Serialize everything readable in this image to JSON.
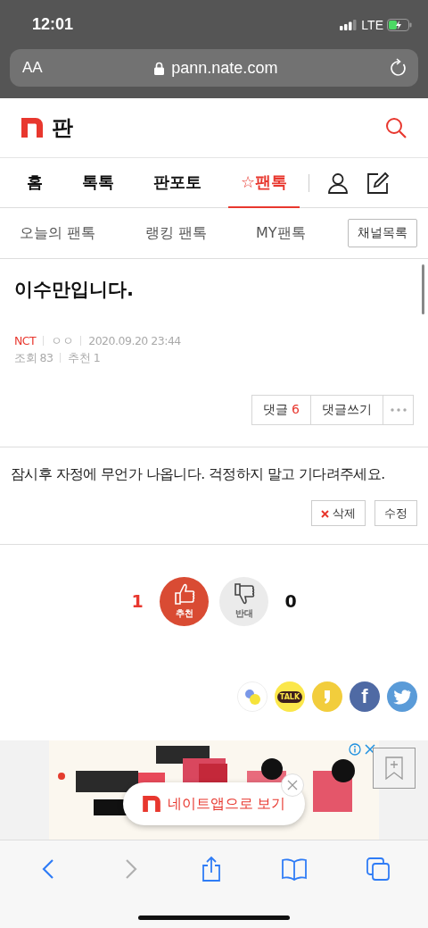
{
  "status_bar": {
    "time": "12:01",
    "network": "LTE"
  },
  "browser": {
    "text_size": "AA",
    "url": "pann.nate.com"
  },
  "header": {
    "logo_text": "판"
  },
  "nav": [
    {
      "label": "홈",
      "selected": false
    },
    {
      "label": "톡톡",
      "selected": false
    },
    {
      "label": "판포토",
      "selected": false
    },
    {
      "label": "☆팬톡",
      "selected": true
    }
  ],
  "subnav": {
    "tabs": [
      {
        "label": "오늘의 팬톡",
        "selected": false
      },
      {
        "label": "랭킹 팬톡",
        "selected": false
      },
      {
        "label": "MY팬톡",
        "selected": false
      }
    ],
    "channel_button": "채널목록"
  },
  "post": {
    "title": "이수만입니다.",
    "channel": "NCT",
    "author": "ㅇㅇ",
    "date": "2020.09.20 23:44",
    "views": "조회 83",
    "recommends": "추천 1",
    "comment_label": "댓글",
    "comment_count": "6",
    "write_comment": "댓글쓰기",
    "body": "잠시후 자정에 무언가 나옵니다. 걱정하지 말고 기다려주세요.",
    "delete": "삭제",
    "edit": "수정"
  },
  "vote": {
    "up_count": "1",
    "up_label": "추천",
    "down_label": "반대",
    "down_count": "0"
  },
  "share": [
    {
      "kind": "band"
    },
    {
      "kind": "kakaotalk",
      "label": "TALK"
    },
    {
      "kind": "kakaostory"
    },
    {
      "kind": "facebook",
      "label": "f"
    },
    {
      "kind": "twitter"
    }
  ],
  "app_banner": {
    "label": "네이트앱으로 보기"
  },
  "toolbar": [
    {
      "kind": "back",
      "disabled": false
    },
    {
      "kind": "forward",
      "disabled": true
    },
    {
      "kind": "share",
      "disabled": false
    },
    {
      "kind": "bookmarks",
      "disabled": false
    },
    {
      "kind": "tabs",
      "disabled": false
    }
  ]
}
